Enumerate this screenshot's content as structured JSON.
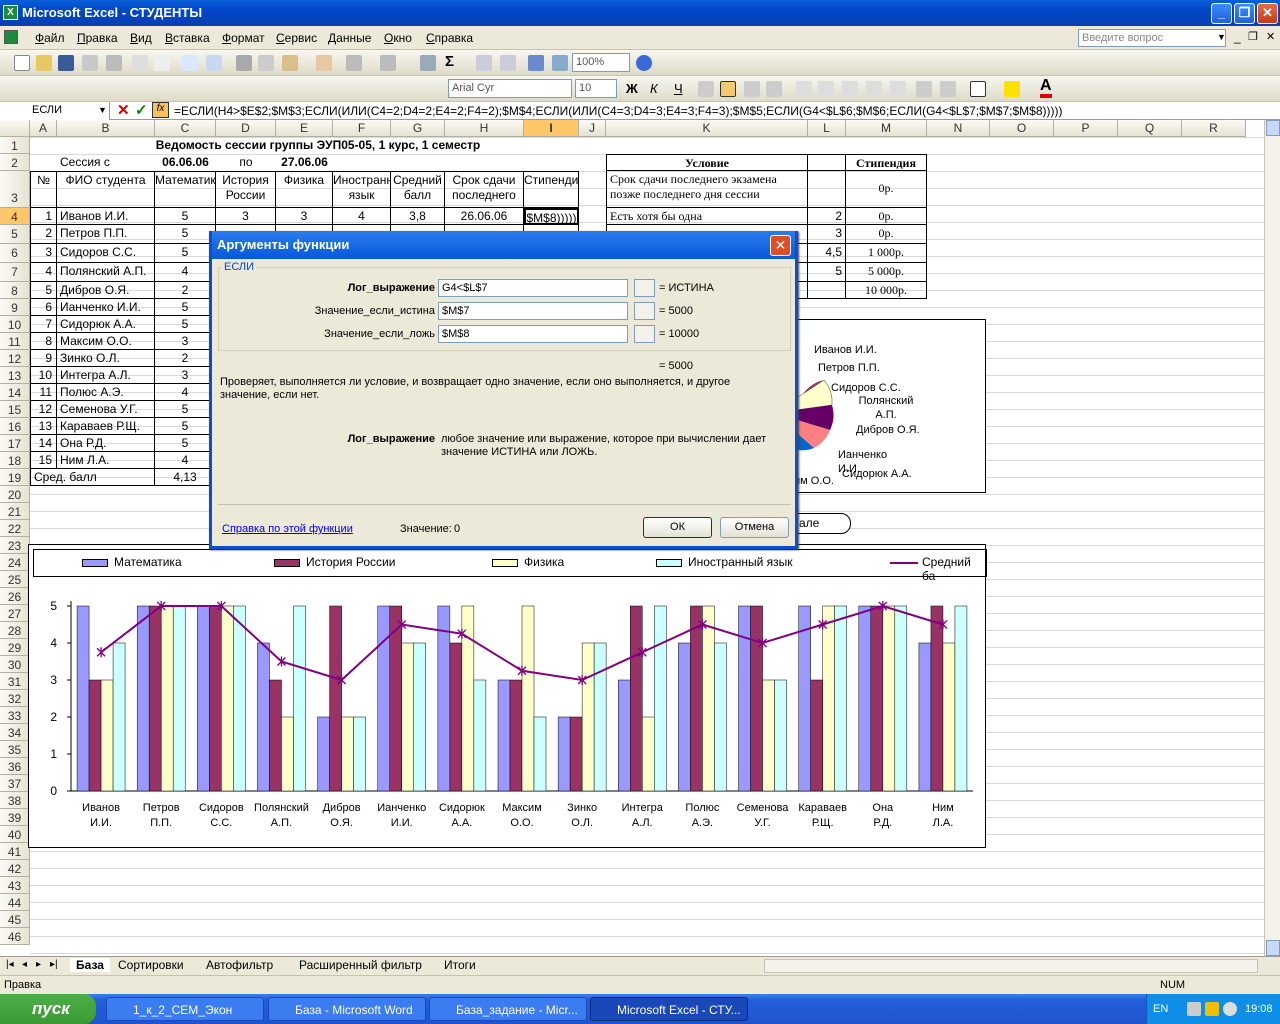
{
  "window": {
    "title": "Microsoft Excel - СТУДЕНТЫ"
  },
  "menu": [
    "Файл",
    "Правка",
    "Вид",
    "Вставка",
    "Формат",
    "Сервис",
    "Данные",
    "Окно",
    "Справка"
  ],
  "ask_placeholder": "Введите вопрос",
  "toolbar": {
    "zoom": "100%",
    "font": "Arial Cyr",
    "size": "10"
  },
  "formula_bar": {
    "name_box": "ЕСЛИ",
    "formula": "=ЕСЛИ(H4>$E$2;$M$3;ЕСЛИ(ИЛИ(C4=2;D4=2;E4=2;F4=2);$M$4;ЕСЛИ(ИЛИ(C4=3;D4=3;E4=3;F4=3);$M$5;ЕСЛИ(G4<$L$6;$M$6;ЕСЛИ(G4<$L$7;$M$7;$M$8)))))"
  },
  "columns": [
    "A",
    "B",
    "C",
    "D",
    "E",
    "F",
    "G",
    "H",
    "I",
    "J",
    "K",
    "L",
    "M",
    "N",
    "O",
    "P",
    "Q",
    "R"
  ],
  "rows": [
    "1",
    "2",
    "3",
    "4",
    "5",
    "6",
    "7",
    "8",
    "9",
    "10",
    "11",
    "12",
    "13",
    "14",
    "15",
    "16",
    "17",
    "18",
    "19",
    "20",
    "21",
    "22",
    "23",
    "24",
    "25",
    "26",
    "27",
    "28",
    "29",
    "30",
    "31",
    "32",
    "33",
    "34",
    "35",
    "36",
    "37",
    "38",
    "39",
    "40",
    "41",
    "42",
    "43",
    "44",
    "45",
    "46"
  ],
  "sheet": {
    "title": "Ведомость сессии группы ЭУП05-05, 1 курс, 1 семестр",
    "session_from_label": "Сессия с",
    "session_from": "06.06.06",
    "session_to_label": "по",
    "session_to": "27.06.06",
    "headers": [
      "№",
      "ФИО студента",
      "Математика",
      "История России",
      "Физика",
      "Иностранный язык",
      "Средний балл",
      "Срок сдачи последнего экзамена",
      "Стипендия"
    ],
    "students": [
      {
        "n": "1",
        "name": "Иванов И.И.",
        "math": "5",
        "hist": "3",
        "phys": "3",
        "lang": "4",
        "avg": "3,8",
        "date": "26.06.06",
        "stip": "$M$8)))))"
      },
      {
        "n": "2",
        "name": "Петров П.П.",
        "math": "5"
      },
      {
        "n": "3",
        "name": "Сидоров С.С.",
        "math": "5"
      },
      {
        "n": "4",
        "name": "Полянский А.П.",
        "math": "4"
      },
      {
        "n": "5",
        "name": "Дибров О.Я.",
        "math": "2"
      },
      {
        "n": "6",
        "name": "Ианченко И.И.",
        "math": "5"
      },
      {
        "n": "7",
        "name": "Сидорюк А.А.",
        "math": "5"
      },
      {
        "n": "8",
        "name": "Максим О.О.",
        "math": "3"
      },
      {
        "n": "9",
        "name": "Зинко О.Л.",
        "math": "2"
      },
      {
        "n": "10",
        "name": "Интегра А.Л.",
        "math": "3"
      },
      {
        "n": "11",
        "name": "Полюс А.Э.",
        "math": "4"
      },
      {
        "n": "12",
        "name": "Семенова У.Г.",
        "math": "5"
      },
      {
        "n": "13",
        "name": "Караваев Р.Щ.",
        "math": "5"
      },
      {
        "n": "14",
        "name": "Она Р.Д.",
        "math": "5"
      },
      {
        "n": "15",
        "name": "Ним Л.А.",
        "math": "4"
      }
    ],
    "avg_label": "Сред. балл",
    "avg_math": "4,13",
    "conditions": {
      "header_cond": "Условие",
      "header_stip": "Стипендия",
      "rows": [
        {
          "cond": "Срок сдачи последнего экзамена позже последнего дня сессии",
          "val": "",
          "stip": "0р."
        },
        {
          "cond": "Есть хотя бы одна",
          "val": "2",
          "stip": "0р."
        },
        {
          "cond": "",
          "val": "3",
          "stip": "0р."
        },
        {
          "cond": "",
          "val": "4,5",
          "stip": "1 000р."
        },
        {
          "cond": "",
          "val": "5",
          "stip": "5 000р."
        },
        {
          "cond": "",
          "val": "",
          "stip": "10 000р."
        }
      ]
    },
    "pie_labels": [
      "Иванов И.И.",
      "Петров П.П.",
      "Сидоров С.С.",
      "Полянский А.П.",
      "Дибров О.Я.",
      "Ианченко И.И.",
      "Сидорюк А.А.",
      "им О.О."
    ],
    "button_partial": "але"
  },
  "dialog": {
    "title": "Аргументы функции",
    "func": "ЕСЛИ",
    "args": [
      {
        "label": "Лог_выражение",
        "value": "G4<$L$7",
        "result": "= ИСТИНА"
      },
      {
        "label": "Значение_если_истина",
        "value": "$M$7",
        "result": "= 5000"
      },
      {
        "label": "Значение_если_ложь",
        "value": "$M$8",
        "result": "= 10000"
      }
    ],
    "total": "= 5000",
    "desc": "Проверяет, выполняется ли условие, и возвращает одно значение, если оно выполняется, и другое значение, если нет.",
    "arg_name": "Лог_выражение",
    "arg_desc": "любое значение или выражение, которое при вычислении дает значение ИСТИНА или ЛОЖЬ.",
    "help": "Справка по этой функции",
    "value_label": "Значение:",
    "value": "0",
    "ok": "ОК",
    "cancel": "Отмена"
  },
  "chart_data": {
    "type": "bar",
    "categories": [
      "Иванов И.И.",
      "Петров П.П.",
      "Сидоров С.С.",
      "Полянский А.П.",
      "Дибров О.Я.",
      "Ианченко И.И.",
      "Сидорюк А.А.",
      "Максим О.О.",
      "Зинко О.Л.",
      "Интегра А.Л.",
      "Полюс А.Э.",
      "Семенова У.Г.",
      "Караваев Р.Щ.",
      "Она Р.Д.",
      "Ним Л.А."
    ],
    "series": [
      {
        "name": "Математика",
        "color": "#9999ff",
        "values": [
          5,
          5,
          5,
          4,
          2,
          5,
          5,
          3,
          2,
          3,
          4,
          5,
          5,
          5,
          4
        ]
      },
      {
        "name": "История России",
        "color": "#993366",
        "values": [
          3,
          5,
          5,
          3,
          5,
          5,
          4,
          3,
          2,
          5,
          5,
          5,
          3,
          5,
          5
        ]
      },
      {
        "name": "Физика",
        "color": "#ffffcc",
        "values": [
          3,
          5,
          5,
          2,
          2,
          4,
          5,
          5,
          4,
          2,
          5,
          3,
          5,
          5,
          4
        ]
      },
      {
        "name": "Иностранный язык",
        "color": "#ccffff",
        "values": [
          4,
          5,
          5,
          5,
          2,
          4,
          3,
          2,
          4,
          5,
          4,
          3,
          5,
          5,
          5
        ]
      }
    ],
    "line": {
      "name": "Средний ба",
      "color": "#800080",
      "values": [
        3.75,
        5,
        5,
        3.5,
        3,
        4.5,
        4.25,
        3.25,
        3,
        3.75,
        4.5,
        4,
        4.5,
        5,
        4.5
      ]
    },
    "ylim": [
      0,
      5
    ],
    "yticks": [
      "0",
      "1",
      "2",
      "3",
      "4",
      "5"
    ],
    "legend": "top"
  },
  "tabs": [
    "База",
    "Сортировки",
    "Автофильтр",
    "Расширенный фильтр",
    "Итоги"
  ],
  "status": {
    "left": "Правка",
    "num": "NUM"
  },
  "taskbar": {
    "start": "пуск",
    "tasks": [
      "1_к_2_СЕМ_Экон",
      "База - Microsoft Word",
      "База_задание - Micr...",
      "Microsoft Excel - СТУ..."
    ],
    "lang": "EN",
    "time": "19:08"
  }
}
